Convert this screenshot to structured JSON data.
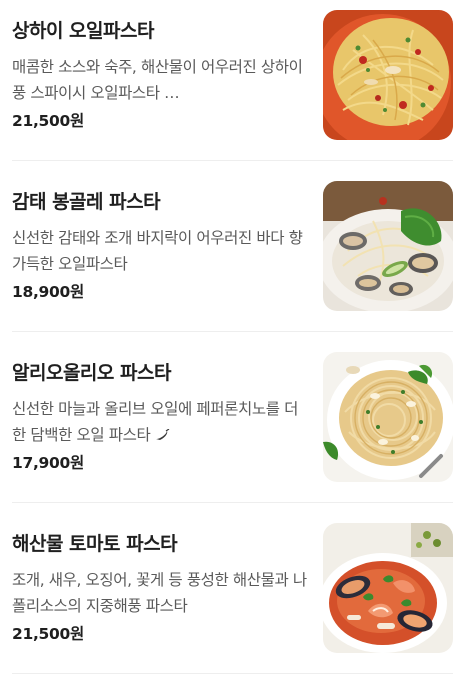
{
  "menu": {
    "items": [
      {
        "name": "상하이 오일파스타",
        "description": "매콤한 소스와 숙주, 해산물이 어우러진 상하이풍 스파이시 오일파스타 …",
        "price": "21,500원",
        "image_icon": "shanghai-oil-pasta-photo"
      },
      {
        "name": "감태 봉골레 파스타",
        "description": "신선한 감태와 조개 바지락이 어우러진 바다 향 가득한 오일파스타",
        "price": "18,900원",
        "image_icon": "gamtae-vongole-pasta-photo"
      },
      {
        "name": "알리오올리오 파스타",
        "description": "신선한 마늘과 올리브 오일에 페퍼론치노를 더한 담백한 오일 파스타",
        "price": "17,900원",
        "image_icon": "aglio-olio-pasta-photo",
        "badge_icon": "chili-pepper-icon"
      },
      {
        "name": "해산물 토마토 파스타",
        "description": "조개, 새우, 오징어, 꽃게 등 풍성한 해산물과 나폴리소스의 지중해풍 파스타",
        "price": "21,500원",
        "image_icon": "seafood-tomato-pasta-photo"
      }
    ]
  },
  "colors": {
    "text_primary": "#1f1f1f",
    "text_secondary": "#5a5a5a",
    "divider": "#eeeeee"
  }
}
